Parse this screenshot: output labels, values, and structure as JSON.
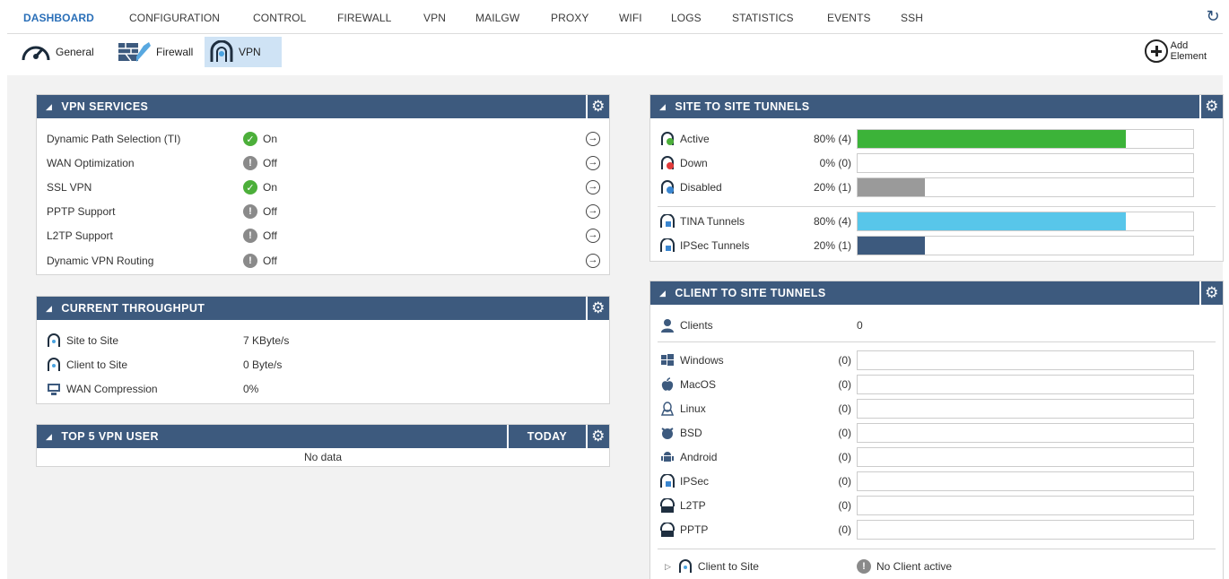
{
  "nav": {
    "tabs": [
      "DASHBOARD",
      "CONFIGURATION",
      "CONTROL",
      "FIREWALL",
      "VPN",
      "MAILGW",
      "PROXY",
      "WIFI",
      "LOGS",
      "STATISTICS",
      "EVENTS",
      "SSH"
    ],
    "active": "DASHBOARD"
  },
  "subnav": {
    "general": "General",
    "firewall": "Firewall",
    "vpn": "VPN",
    "add_line1": "Add",
    "add_line2": "Element"
  },
  "vpn_services": {
    "title": "VPN SERVICES",
    "rows": [
      {
        "label": "Dynamic Path Selection (TI)",
        "status": "On"
      },
      {
        "label": "WAN Optimization",
        "status": "Off"
      },
      {
        "label": "SSL VPN",
        "status": "On"
      },
      {
        "label": "PPTP Support",
        "status": "Off"
      },
      {
        "label": "L2TP Support",
        "status": "Off"
      },
      {
        "label": "Dynamic VPN Routing",
        "status": "Off"
      }
    ]
  },
  "throughput": {
    "title": "CURRENT THROUGHPUT",
    "rows": [
      {
        "label": "Site to Site",
        "value": "7 KByte/s"
      },
      {
        "label": "Client to Site",
        "value": "0  Byte/s"
      },
      {
        "label": "WAN Compression",
        "value": "0%"
      }
    ]
  },
  "top5": {
    "title": "TOP 5 VPN USER",
    "period": "TODAY",
    "empty": "No data"
  },
  "site_tunnels": {
    "title": "SITE TO SITE TUNNELS",
    "rows": [
      {
        "label": "Active",
        "pct": "80% (4)",
        "fraction": 0.8,
        "color": "#3cb339"
      },
      {
        "label": "Down",
        "pct": "0% (0)",
        "fraction": 0,
        "color": "#3cb339"
      },
      {
        "label": "Disabled",
        "pct": "20% (1)",
        "fraction": 0.2,
        "color": "#9a9a9a"
      },
      {
        "label": "TINA Tunnels",
        "pct": "80% (4)",
        "fraction": 0.8,
        "color": "#58c6ea"
      },
      {
        "label": "IPSec Tunnels",
        "pct": "20% (1)",
        "fraction": 0.2,
        "color": "#3d5a7e"
      }
    ]
  },
  "client_tunnels": {
    "title": "CLIENT TO SITE TUNNELS",
    "clients_label": "Clients",
    "clients_value": "0",
    "rows": [
      {
        "label": "Windows",
        "count": "(0)"
      },
      {
        "label": "MacOS",
        "count": "(0)"
      },
      {
        "label": "Linux",
        "count": "(0)"
      },
      {
        "label": "BSD",
        "count": "(0)"
      },
      {
        "label": "Android",
        "count": "(0)"
      },
      {
        "label": "IPSec",
        "count": "(0)"
      },
      {
        "label": "L2TP",
        "count": "(0)"
      },
      {
        "label": "PPTP",
        "count": "(0)"
      }
    ],
    "footer_label": "Client to Site",
    "footer_status": "No Client active"
  }
}
